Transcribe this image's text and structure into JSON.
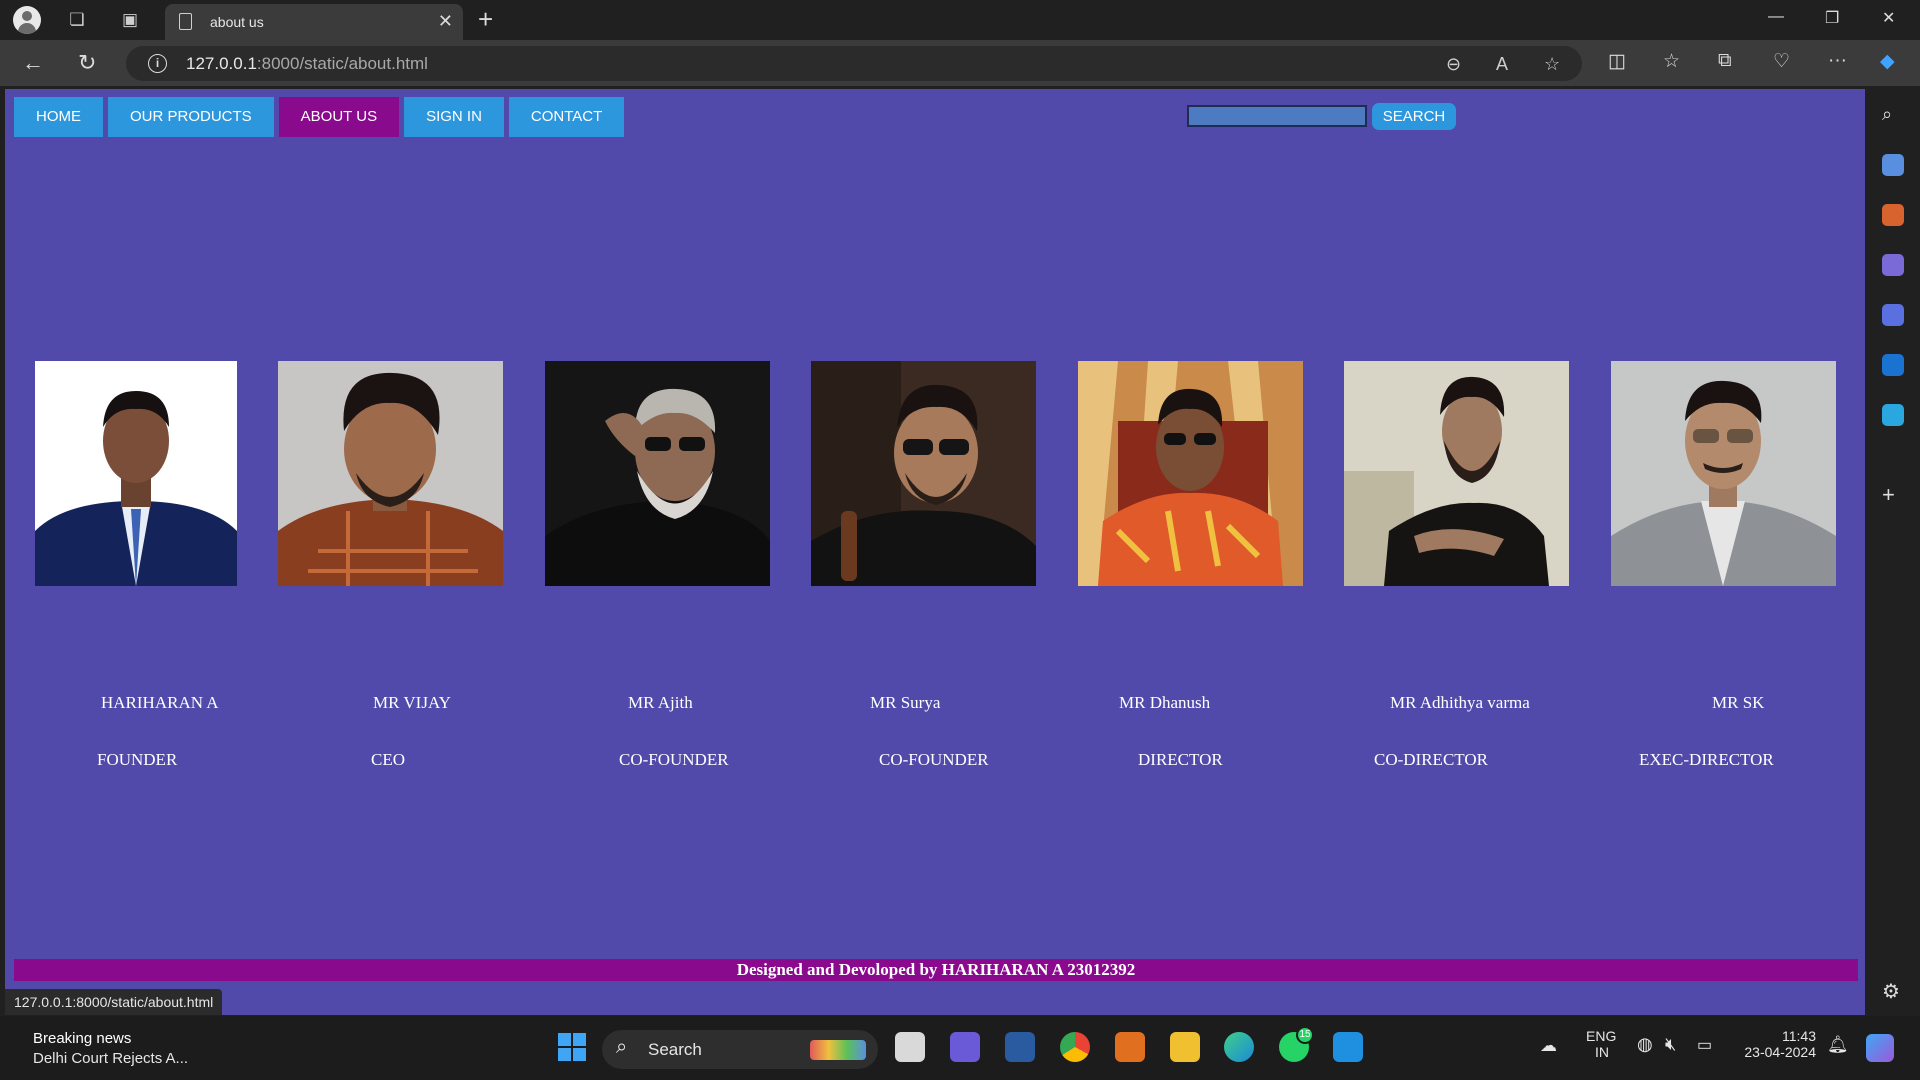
{
  "browser": {
    "tab_title": "about us",
    "url_host": "127.0.0.1",
    "url_rest": ":8000/static/about.html",
    "status_url": "127.0.0.1:8000/static/about.html"
  },
  "page": {
    "nav": [
      {
        "label": "HOME"
      },
      {
        "label": "OUR PRODUCTS"
      },
      {
        "label": "ABOUT US"
      },
      {
        "label": "SIGN IN"
      },
      {
        "label": "CONTACT"
      }
    ],
    "active_nav": "ABOUT US",
    "search_button": "SEARCH",
    "search_value": "",
    "team": [
      {
        "name": "HARIHARAN A",
        "role": "FOUNDER"
      },
      {
        "name": "MR VIJAY",
        "role": "CEO"
      },
      {
        "name": "MR Ajith",
        "role": "CO-FOUNDER"
      },
      {
        "name": "MR Surya",
        "role": "CO-FOUNDER"
      },
      {
        "name": "MR Dhanush",
        "role": "DIRECTOR"
      },
      {
        "name": "MR Adhithya varma",
        "role": "CO-DIRECTOR"
      },
      {
        "name": "MR SK",
        "role": "EXEC-DIRECTOR"
      }
    ],
    "footer": "Designed and Devoloped by HARIHARAN A 23012392"
  },
  "taskbar": {
    "news_title": "Breaking news",
    "news_sub": "Delhi Court Rejects A...",
    "search_label": "Search",
    "whatsapp_badge": "15",
    "lang": "ENG",
    "region": "IN",
    "time": "11:43",
    "date": "23-04-2024"
  },
  "colors": {
    "page_bg": "#514aaa",
    "nav_btn": "#2d97de",
    "nav_active": "#8a0a8e",
    "footer_bg": "#8a0a8e"
  }
}
